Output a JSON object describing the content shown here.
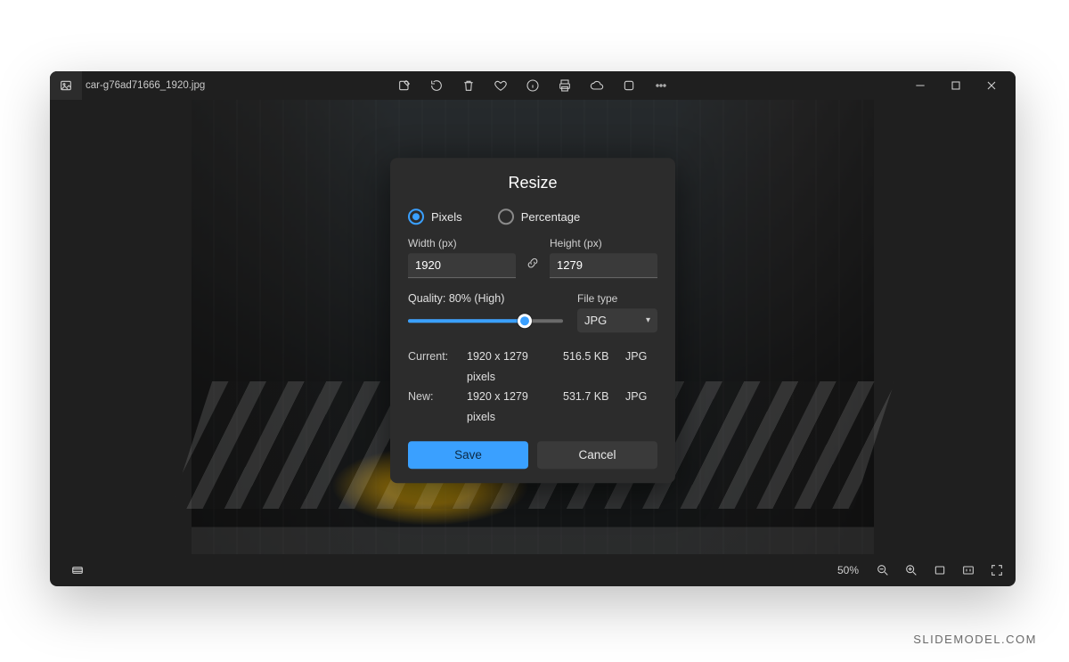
{
  "titlebar": {
    "filename": "car-g76ad71666_1920.jpg"
  },
  "dialog": {
    "title": "Resize",
    "radio_pixels": "Pixels",
    "radio_percentage": "Percentage",
    "width_label": "Width (px)",
    "height_label": "Height (px)",
    "width_value": "1920",
    "height_value": "1279",
    "quality_label": "Quality: 80% (High)",
    "filetype_label": "File type",
    "filetype_value": "JPG",
    "current_label": "Current:",
    "new_label": "New:",
    "current_dims": "1920 x 1279 pixels",
    "current_size": "516.5 KB",
    "current_fmt": "JPG",
    "new_dims": "1920 x 1279 pixels",
    "new_size": "531.7 KB",
    "new_fmt": "JPG",
    "save": "Save",
    "cancel": "Cancel"
  },
  "bottombar": {
    "zoom": "50%"
  },
  "watermark": "SLIDEMODEL.COM"
}
